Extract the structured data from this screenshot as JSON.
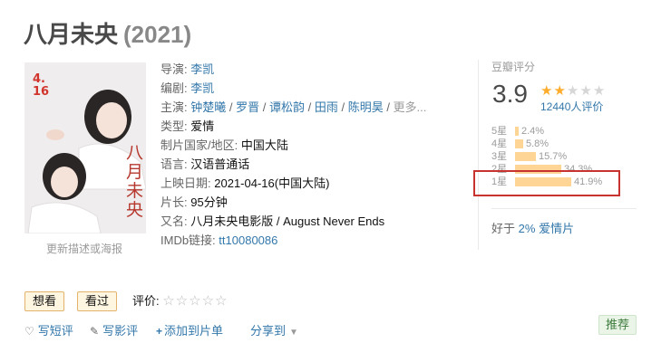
{
  "movie": {
    "title": "八月未央",
    "year": "(2021)"
  },
  "poster": {
    "link_text": "更新描述或海报",
    "overlay_title": "八月未央",
    "overlay_date_month": "4.",
    "overlay_date_day": "16"
  },
  "info": {
    "director": {
      "label": "导演:",
      "value": "李凯"
    },
    "writer": {
      "label": "编剧:",
      "value": "李凯"
    },
    "cast": {
      "label": "主演:",
      "names": [
        "钟楚曦",
        "罗晋",
        "谭松韵",
        "田雨",
        "陈明昊"
      ],
      "separator": " / ",
      "more": "更多..."
    },
    "genre": {
      "label": "类型:",
      "value": "爱情"
    },
    "region": {
      "label": "制片国家/地区:",
      "value": "中国大陆"
    },
    "language": {
      "label": "语言:",
      "value": "汉语普通话"
    },
    "release": {
      "label": "上映日期:",
      "value": "2021-04-16(中国大陆)"
    },
    "runtime": {
      "label": "片长:",
      "value": "95分钟"
    },
    "aka": {
      "label": "又名:",
      "value": "八月未央电影版 / August Never Ends"
    },
    "imdb": {
      "label": "IMDb链接:",
      "value": "tt10080086"
    }
  },
  "rating": {
    "label": "豆瓣评分",
    "score": "3.9",
    "stars_filled": 2,
    "stars_total": 5,
    "votes_text": "12440人评价",
    "distribution": [
      {
        "label": "5星",
        "percent_text": "2.4%",
        "percent": 2.4
      },
      {
        "label": "4星",
        "percent_text": "5.8%",
        "percent": 5.8
      },
      {
        "label": "3星",
        "percent_text": "15.7%",
        "percent": 15.7
      },
      {
        "label": "2星",
        "percent_text": "34.3%",
        "percent": 34.3
      },
      {
        "label": "1星",
        "percent_text": "41.9%",
        "percent": 41.9
      }
    ],
    "better_than": {
      "prefix": "好于",
      "percent": "2%",
      "genre": "爱情片"
    }
  },
  "actions": {
    "want_label": "想看",
    "seen_label": "看过",
    "rate_label": "评价:",
    "short_review_label": "写短评",
    "review_label": "写影评",
    "add_list_label": "添加到片单",
    "share_label": "分享到",
    "recommend_label": "推荐"
  },
  "colors": {
    "link": "#3377aa",
    "star": "#ffac2d",
    "bar": "#ffd596",
    "highlight": "#c8322f",
    "button_bg": "#fff6e1"
  }
}
